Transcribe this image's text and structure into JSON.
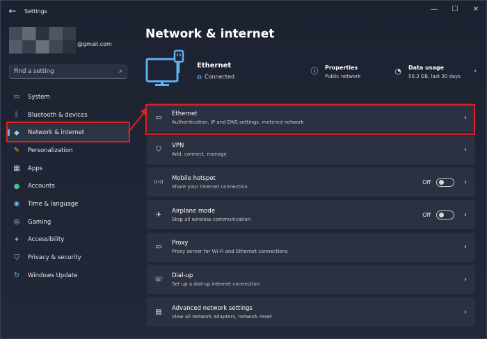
{
  "app": {
    "title": "Settings"
  },
  "window_controls": {
    "minimize": "—",
    "maximize": "☐",
    "close": "✕"
  },
  "profile": {
    "email": "@gmail.com"
  },
  "search": {
    "placeholder": "Find a setting"
  },
  "sidebar": {
    "items": [
      {
        "label": "System",
        "icon": "system-icon",
        "glyph": "▭",
        "color": "#6db8f2"
      },
      {
        "label": "Bluetooth & devices",
        "icon": "bluetooth-icon",
        "glyph": "ᛒ",
        "color": "#6db8f2"
      },
      {
        "label": "Network & internet",
        "icon": "wifi-icon",
        "glyph": "◆",
        "color": "#8fd0ff",
        "active": true
      },
      {
        "label": "Personalization",
        "icon": "brush-icon",
        "glyph": "✎",
        "color": "#f0a040"
      },
      {
        "label": "Apps",
        "icon": "apps-icon",
        "glyph": "▦",
        "color": "#c9ccd4"
      },
      {
        "label": "Accounts",
        "icon": "accounts-icon",
        "glyph": "●",
        "color": "#3fc48a"
      },
      {
        "label": "Time & language",
        "icon": "globe-clock-icon",
        "glyph": "◉",
        "color": "#6db8f2"
      },
      {
        "label": "Gaming",
        "icon": "gaming-icon",
        "glyph": "◎",
        "color": "#c9ccd4"
      },
      {
        "label": "Accessibility",
        "icon": "accessibility-icon",
        "glyph": "✦",
        "color": "#6db8f2"
      },
      {
        "label": "Privacy & security",
        "icon": "shield-icon",
        "glyph": "⛉",
        "color": "#c9ccd4"
      },
      {
        "label": "Windows Update",
        "icon": "update-icon",
        "glyph": "↻",
        "color": "#6db8f2"
      }
    ]
  },
  "main": {
    "title": "Network & internet",
    "hero": {
      "name": "Ethernet",
      "status": "Connected",
      "properties": {
        "title": "Properties",
        "sub": "Public network"
      },
      "data_usage": {
        "title": "Data usage",
        "sub": "50.3 GB, last 30 days"
      }
    },
    "rows": [
      {
        "title": "Ethernet",
        "sub": "Authentication, IP and DNS settings, metered network",
        "icon": "monitor-icon",
        "glyph": "▭"
      },
      {
        "title": "VPN",
        "sub": "Add, connect, manage",
        "icon": "vpn-shield-icon",
        "glyph": "⛉"
      },
      {
        "title": "Mobile hotspot",
        "sub": "Share your internet connection",
        "icon": "hotspot-icon",
        "glyph": "((•))",
        "toggle": "Off"
      },
      {
        "title": "Airplane mode",
        "sub": "Stop all wireless communication",
        "icon": "airplane-icon",
        "glyph": "✈",
        "toggle": "Off"
      },
      {
        "title": "Proxy",
        "sub": "Proxy server for Wi-Fi and Ethernet connections",
        "icon": "proxy-icon",
        "glyph": "▭"
      },
      {
        "title": "Dial-up",
        "sub": "Set up a dial-up internet connection",
        "icon": "dialup-icon",
        "glyph": "☏"
      },
      {
        "title": "Advanced network settings",
        "sub": "View all network adapters, network reset",
        "icon": "network-adapter-icon",
        "glyph": "▤"
      }
    ]
  },
  "colors": {
    "accent": "#5fb2f2",
    "annotation": "#e02020"
  }
}
